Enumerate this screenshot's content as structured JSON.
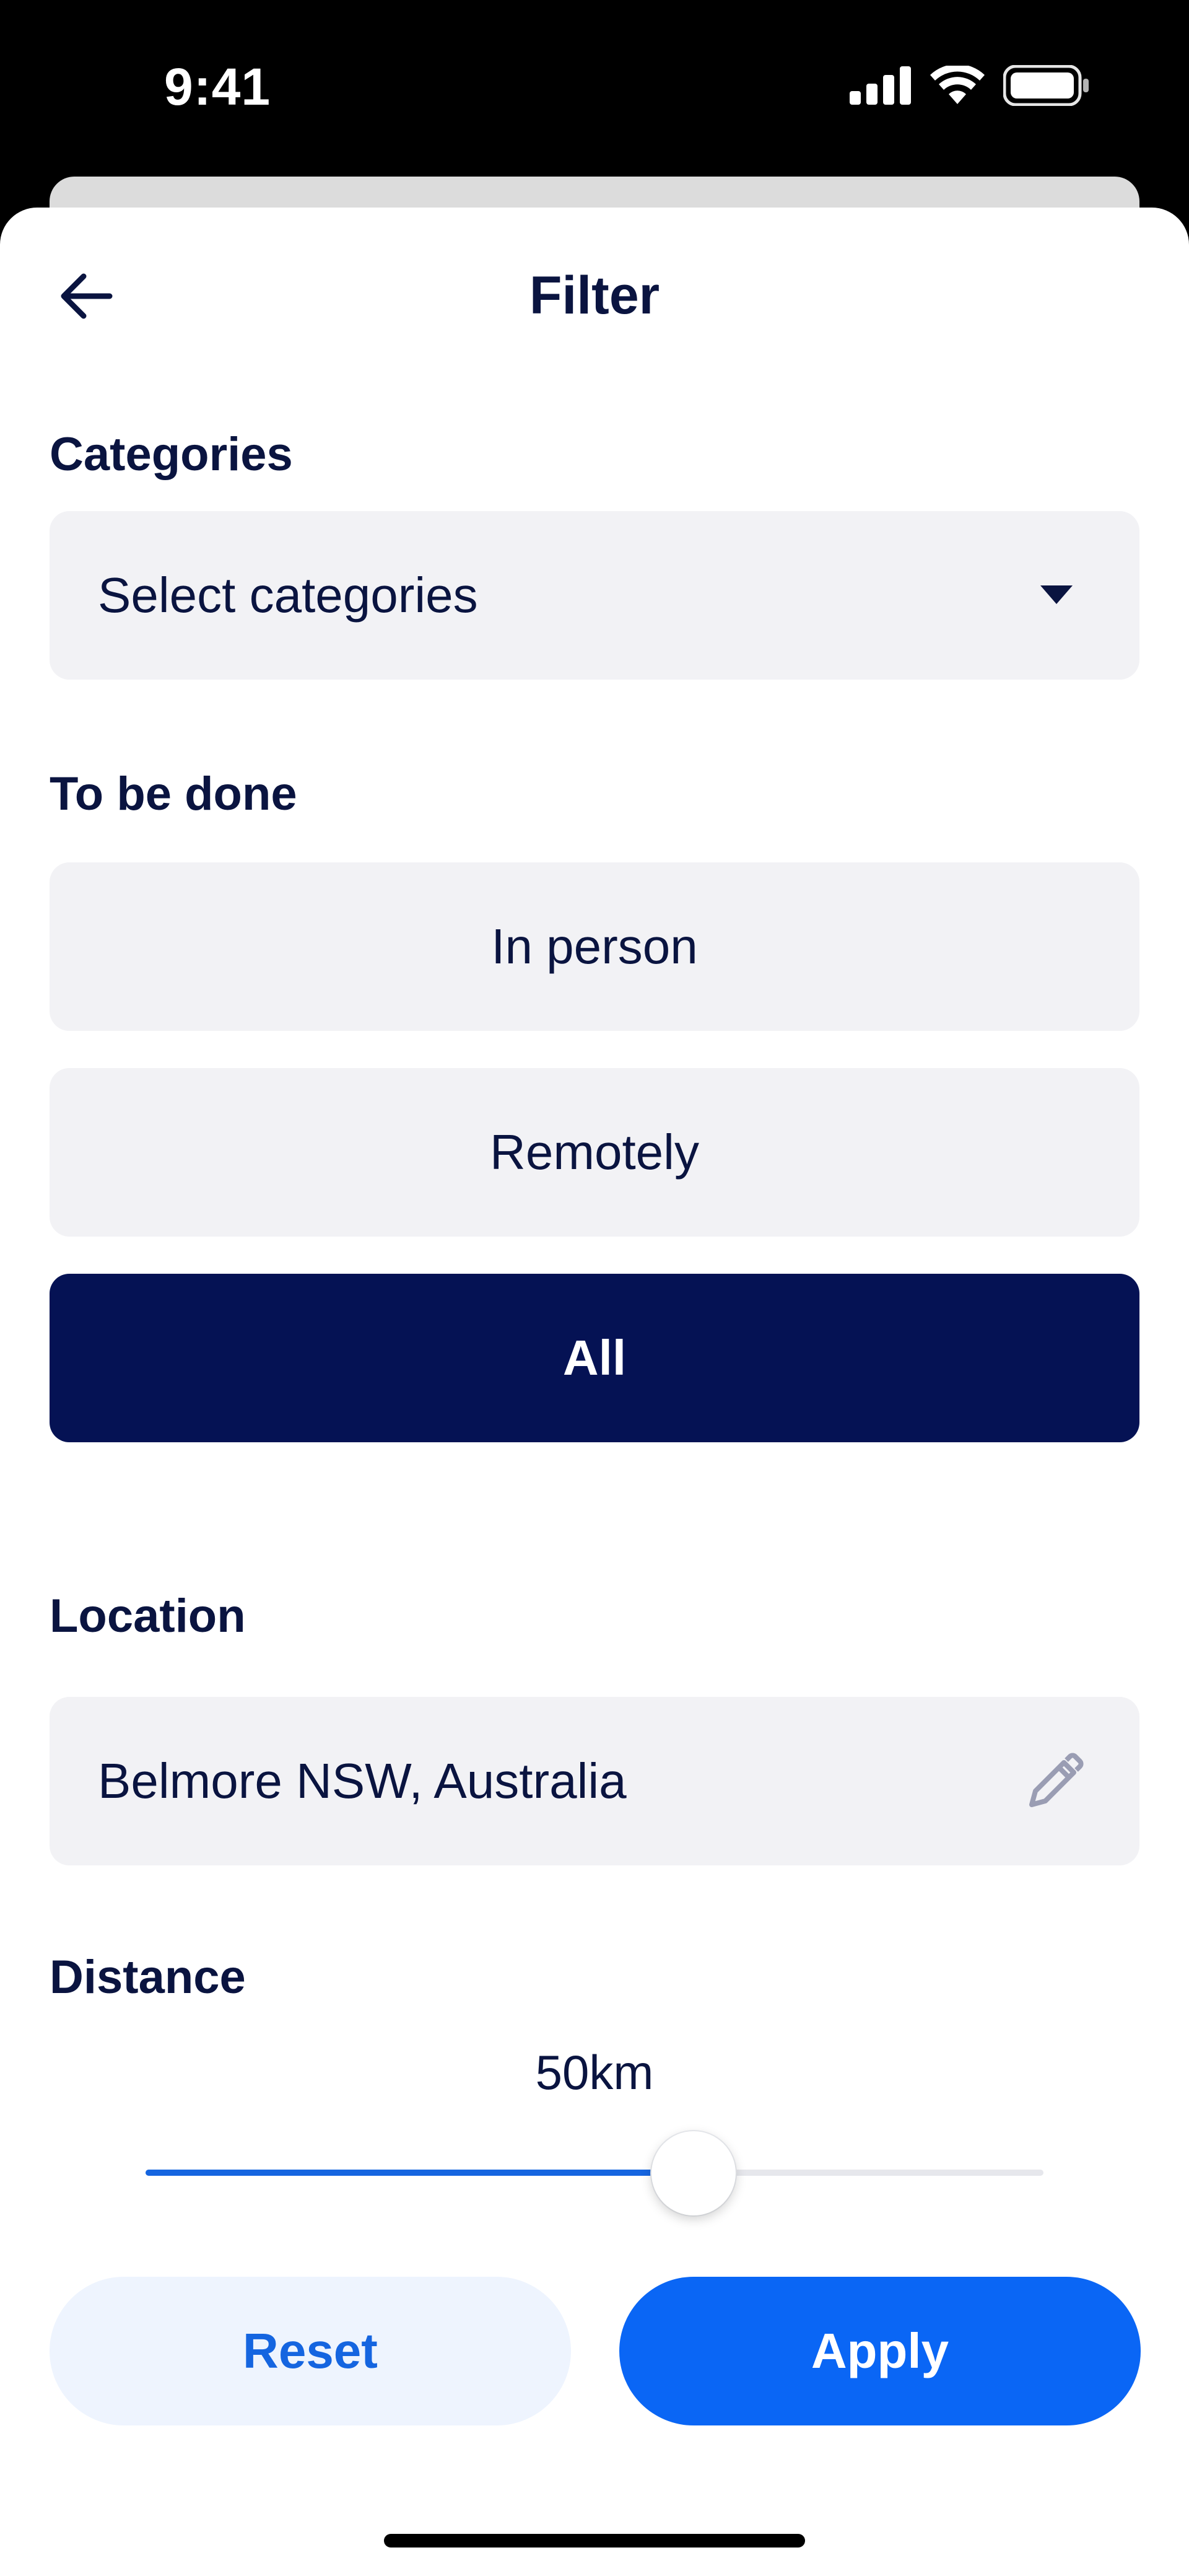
{
  "status_bar": {
    "time": "9:41",
    "icons": [
      "signal-icon",
      "wifi-icon",
      "battery-icon"
    ]
  },
  "header": {
    "back_icon": "arrow-left-icon",
    "title": "Filter"
  },
  "categories": {
    "label": "Categories",
    "value": "Select categories",
    "dropdown_icon": "caret-down-icon"
  },
  "to_be_done": {
    "label": "To be done",
    "options": [
      {
        "label": "In person",
        "selected": false
      },
      {
        "label": "Remotely",
        "selected": false
      },
      {
        "label": "All",
        "selected": true
      }
    ]
  },
  "location": {
    "label": "Location",
    "value": "Belmore NSW, Australia",
    "edit_icon": "pencil-icon"
  },
  "distance": {
    "label": "Distance",
    "value_text": "50km",
    "slider_fraction": 0.61
  },
  "actions": {
    "reset_label": "Reset",
    "apply_label": "Apply"
  },
  "colors": {
    "primary_dark": "#051254",
    "accent_blue": "#0a66f5",
    "field_bg": "#f2f2f5",
    "text": "#0a1440"
  }
}
